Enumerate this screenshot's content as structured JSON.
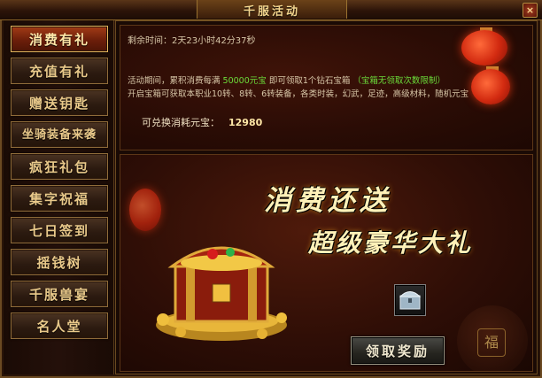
{
  "window": {
    "title": "千服活动",
    "close_glyph": "×"
  },
  "sidebar": {
    "items": [
      {
        "label": "消费有礼",
        "active": true
      },
      {
        "label": "充值有礼"
      },
      {
        "label": "赠送钥匙"
      },
      {
        "label": "坐骑装备来袭"
      },
      {
        "label": "疯狂礼包"
      },
      {
        "label": "集字祝福"
      },
      {
        "label": "七日签到"
      },
      {
        "label": "摇钱树"
      },
      {
        "label": "千服兽宴"
      },
      {
        "label": "名人堂"
      }
    ]
  },
  "info": {
    "countdown": "剩余时间：2天23小时42分37秒",
    "desc_line1_a": "活动期间，累积消费每满",
    "desc_line1_amount": "50000元宝",
    "desc_line1_b": "即可领取1个钻石宝箱",
    "desc_line1_note": "（宝箱无领取次数限制）",
    "desc_line2": "开启宝箱可获取本职业10转、8转、6转装备，各类时装，幻武，足迹，高级材料，随机元宝",
    "redeem_label": "可兑换消耗元宝：",
    "redeem_value": "12980"
  },
  "banner": {
    "slogan1": "消费还送",
    "slogan2": "超级豪华大礼",
    "reward_icon": "silver-chest-icon",
    "claim_label": "领取奖励",
    "urn_char": "福"
  },
  "colors": {
    "accent_gold": "#f3d58e",
    "highlight_green": "#6bdc3a",
    "active_tab": "#a33c16",
    "lantern_red": "#d22a10"
  }
}
